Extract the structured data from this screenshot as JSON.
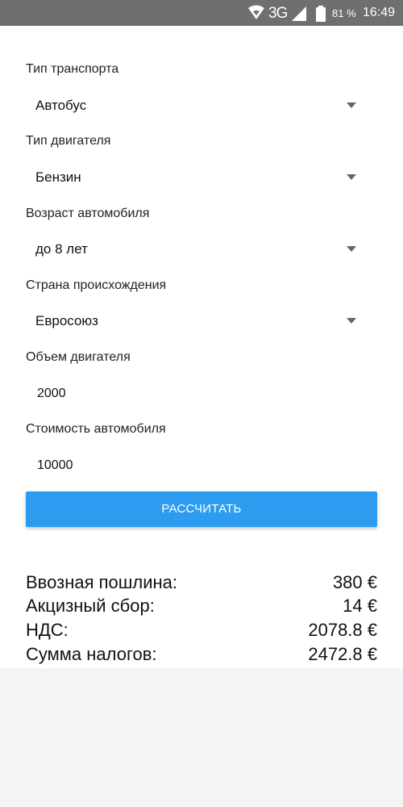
{
  "status_bar": {
    "network": "3G",
    "battery_pct": "81 %",
    "time": "16:49",
    "icons": [
      "wifi-icon",
      "signal-icon",
      "battery-icon"
    ]
  },
  "form": {
    "transport_type": {
      "label": "Тип транспорта",
      "value": "Автобус"
    },
    "engine_type": {
      "label": "Тип двигателя",
      "value": "Бензин"
    },
    "car_age": {
      "label": "Возраст автомобиля",
      "value": "до 8 лет"
    },
    "origin_country": {
      "label": "Страна происхождения",
      "value": "Евросоюз"
    },
    "engine_volume": {
      "label": "Объем двигателя",
      "value": "2000"
    },
    "car_cost": {
      "label": "Стоимость автомобиля",
      "value": "10000"
    }
  },
  "calculate_button": {
    "label": "РАССЧИТАТЬ",
    "color": "#2d9cf0"
  },
  "results": {
    "import_duty": {
      "label": "Ввозная пошлина:",
      "value": "380 €"
    },
    "excise": {
      "label": "Акцизный сбор:",
      "value": "14 €"
    },
    "vat": {
      "label": "НДС:",
      "value": "2078.8 €"
    },
    "total": {
      "label": "Сумма налогов:",
      "value": "2472.8 €"
    }
  }
}
